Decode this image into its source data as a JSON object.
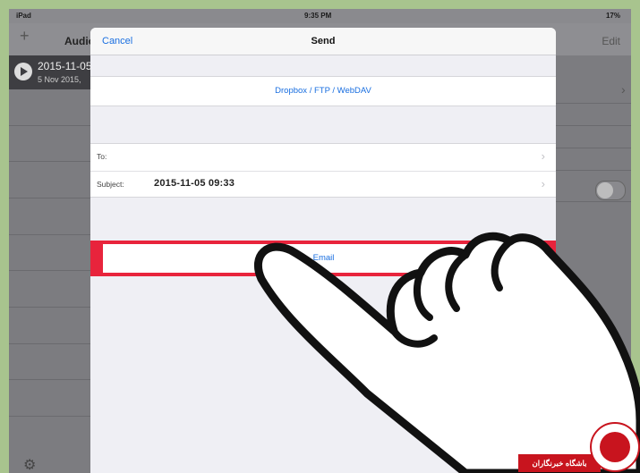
{
  "status_bar": {
    "device": "iPad",
    "time": "9:35 PM",
    "battery": "17%"
  },
  "background": {
    "plus": "+",
    "title": "Audio",
    "edit": "Edit",
    "recording_title": "2015-11-05",
    "recording_date": "5 Nov 2015,"
  },
  "modal": {
    "cancel": "Cancel",
    "title": "Send",
    "dropbox_option": "Dropbox / FTP / WebDAV",
    "to_label": "To:",
    "to_value": "",
    "subject_label": "Subject:",
    "subject_value": "2015-11-05 09:33",
    "email_option": "Email"
  },
  "colors": {
    "accent": "#1a6fe0",
    "highlight": "#e8243c"
  },
  "watermark": {
    "text": "باشگاه خبرنگاران"
  }
}
